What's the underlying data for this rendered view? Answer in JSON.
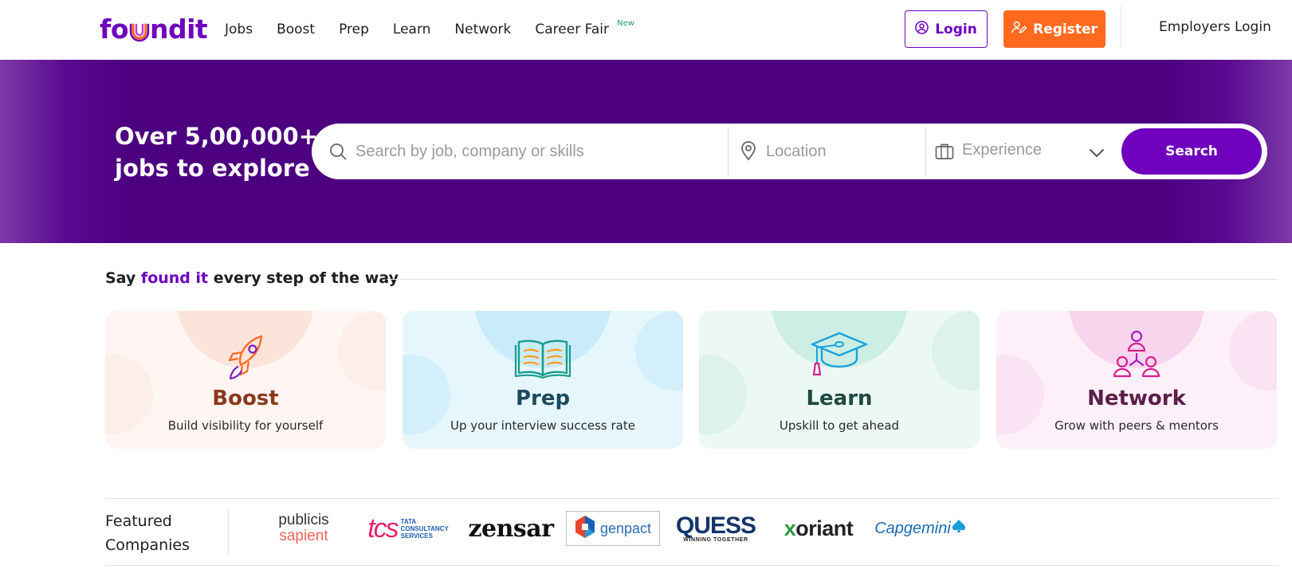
{
  "header": {
    "logo_text": "foundit",
    "nav": [
      {
        "label": "Jobs"
      },
      {
        "label": "Boost"
      },
      {
        "label": "Prep"
      },
      {
        "label": "Learn"
      },
      {
        "label": "Network"
      },
      {
        "label": "Career Fair",
        "badge": "New"
      }
    ],
    "login_label": "Login",
    "register_label": "Register",
    "employers_login_label": "Employers Login"
  },
  "hero": {
    "title_line1": "Over 5,00,000+",
    "title_line2": "jobs to explore",
    "search_placeholder": "Search by job, company or skills",
    "location_placeholder": "Location",
    "experience_placeholder": "Experience",
    "search_button_label": "Search"
  },
  "section": {
    "prefix": "Say ",
    "highlight": "found it",
    "suffix": " every step of the way"
  },
  "cards": [
    {
      "title": "Boost",
      "subtitle": "Build visibility for yourself",
      "icon": "rocket-icon"
    },
    {
      "title": "Prep",
      "subtitle": "Up your interview success rate",
      "icon": "book-icon"
    },
    {
      "title": "Learn",
      "subtitle": "Upskill to get ahead",
      "icon": "graduation-cap-icon"
    },
    {
      "title": "Network",
      "subtitle": "Grow with peers & mentors",
      "icon": "network-people-icon"
    }
  ],
  "featured": {
    "label_line1": "Featured",
    "label_line2": "Companies",
    "companies": [
      {
        "name": "publicis sapient",
        "line1": "publicis",
        "line2": "sapient"
      },
      {
        "name": "tcs",
        "mark": "tcs",
        "line1": "TATA",
        "line2": "CONSULTANCY",
        "line3": "SERVICES"
      },
      {
        "name": "zensar",
        "text": "zensar"
      },
      {
        "name": "genpact",
        "text": "genpact"
      },
      {
        "name": "quess",
        "text": "QUESS",
        "tagline": "WINNING TOGETHER"
      },
      {
        "name": "xoriant",
        "x": "x",
        "rest": "oriant"
      },
      {
        "name": "capgemini",
        "text": "Capgemini"
      }
    ]
  },
  "colors": {
    "brand_purple": "#6e00be",
    "hero_bg": "#4c0080",
    "register_orange": "#ff6a1f"
  }
}
